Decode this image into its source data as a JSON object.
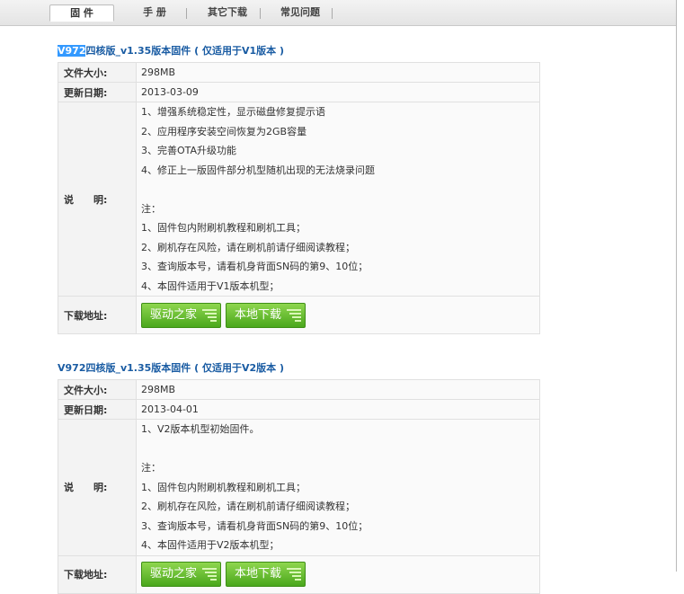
{
  "tabs": [
    {
      "label": "固 件"
    },
    {
      "label": "手 册"
    },
    {
      "label": "其它下载"
    },
    {
      "label": "常见问题"
    }
  ],
  "labels": {
    "size": "文件大小:",
    "date": "更新日期:",
    "desc": "说　　明:",
    "download": "下载地址:"
  },
  "buttons": {
    "driver_home": "驱动之家",
    "local_download": "本地下载"
  },
  "firmwares": [
    {
      "title_highlight": "V972",
      "title_rest": "四核版_v1.35版本固件 ( 仅适用于V1版本 )",
      "size": "298MB",
      "date": "2013-03-09",
      "desc": [
        "1、增强系统稳定性，显示磁盘修复提示语",
        "2、应用程序安装空间恢复为2GB容量",
        "3、完善OTA升级功能",
        "4、修正上一版固件部分机型随机出现的无法烧录问题",
        "",
        "注：",
        "1、固件包内附刷机教程和刷机工具；",
        "2、刷机存在风险，请在刷机前请仔细阅读教程；",
        "3、查询版本号，请看机身背面SN码的第9、10位；",
        "4、本固件适用于V1版本机型；"
      ]
    },
    {
      "title": "V972四核版_v1.35版本固件 ( 仅适用于V2版本 )",
      "size": "298MB",
      "date": "2013-04-01",
      "desc": [
        "1、V2版本机型初始固件。",
        "",
        "注：",
        "1、固件包内附刷机教程和刷机工具；",
        "2、刷机存在风险，请在刷机前请仔细阅读教程；",
        "3、查询版本号，请看机身背面SN码的第9、10位；",
        "4、本固件适用于V2版本机型；"
      ]
    }
  ]
}
